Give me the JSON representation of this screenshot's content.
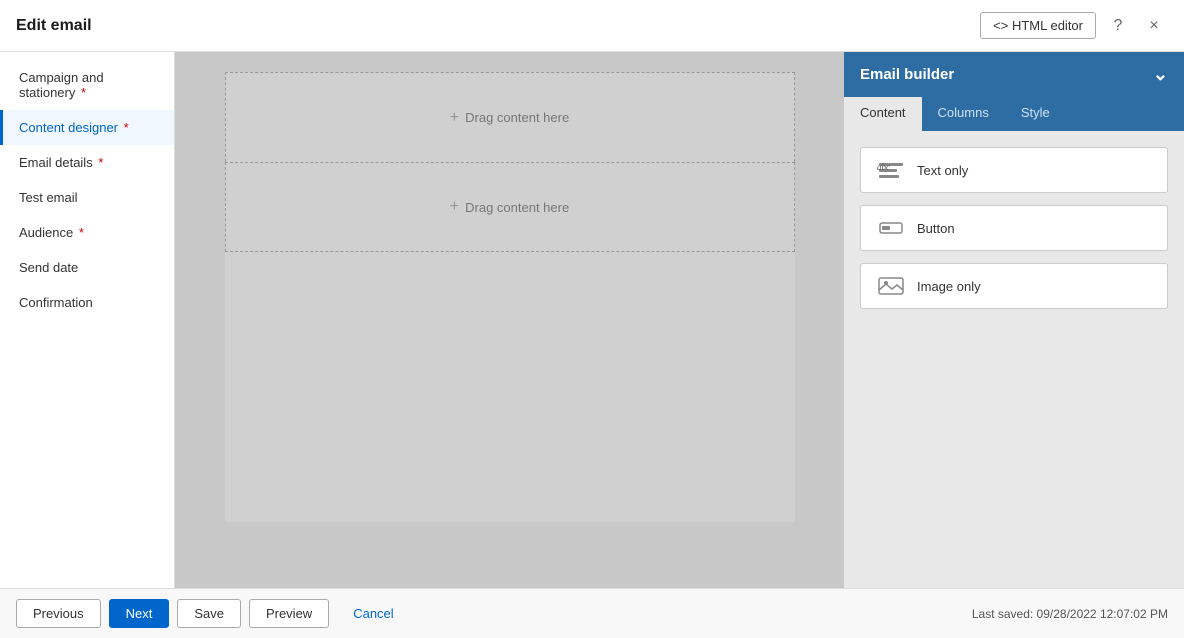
{
  "topbar": {
    "title": "Edit email",
    "html_editor_btn": "<> HTML editor",
    "help_icon": "?",
    "close_icon": "×"
  },
  "sidebar": {
    "items": [
      {
        "label": "Campaign and stationery",
        "required": true,
        "active": false
      },
      {
        "label": "Content designer",
        "required": true,
        "active": true
      },
      {
        "label": "Email details",
        "required": true,
        "active": false
      },
      {
        "label": "Test email",
        "required": false,
        "active": false
      },
      {
        "label": "Audience",
        "required": true,
        "active": false
      },
      {
        "label": "Send date",
        "required": false,
        "active": false
      },
      {
        "label": "Confirmation",
        "required": false,
        "active": false
      }
    ]
  },
  "canvas": {
    "drop_zone_1": "+ Drag content here",
    "drop_zone_2": "+ Drag content here"
  },
  "right_panel": {
    "header": "Email builder",
    "tabs": [
      {
        "label": "Content",
        "active": true
      },
      {
        "label": "Columns",
        "active": false
      },
      {
        "label": "Style",
        "active": false
      }
    ],
    "content_items": [
      {
        "icon_type": "text",
        "label": "Text only"
      },
      {
        "icon_type": "button",
        "label": "Button"
      },
      {
        "icon_type": "image",
        "label": "Image only"
      }
    ]
  },
  "bottom_bar": {
    "previous": "Previous",
    "next": "Next",
    "save": "Save",
    "preview": "Preview",
    "cancel": "Cancel",
    "last_saved": "Last saved: 09/28/2022 12:07:02 PM"
  }
}
